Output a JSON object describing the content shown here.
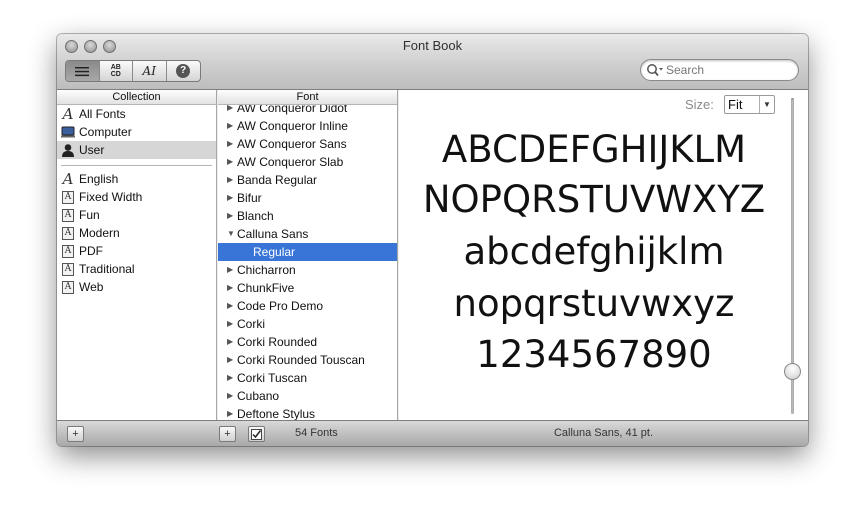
{
  "window": {
    "title": "Font Book"
  },
  "toolbar": {
    "view_buttons": [
      {
        "name": "list-view-icon"
      },
      {
        "name": "abcd-sample-icon",
        "glyph_top": "AB",
        "glyph_bottom": "CD"
      },
      {
        "name": "text-sample-icon",
        "glyph": "AI"
      },
      {
        "name": "info-icon",
        "glyph": "?"
      }
    ],
    "search": {
      "placeholder": "Search"
    }
  },
  "collection": {
    "header": "Collection",
    "system_items": [
      {
        "label": "All Fonts",
        "icon": "font-script-icon"
      },
      {
        "label": "Computer",
        "icon": "computer-icon"
      },
      {
        "label": "User",
        "icon": "user-icon",
        "selected": true
      }
    ],
    "user_items": [
      {
        "label": "English",
        "icon": "font-script-icon"
      },
      {
        "label": "Fixed Width",
        "icon": "collection-icon"
      },
      {
        "label": "Fun",
        "icon": "collection-icon"
      },
      {
        "label": "Modern",
        "icon": "collection-icon"
      },
      {
        "label": "PDF",
        "icon": "collection-icon"
      },
      {
        "label": "Traditional",
        "icon": "collection-icon"
      },
      {
        "label": "Web",
        "icon": "collection-icon"
      }
    ]
  },
  "fonts": {
    "header": "Font",
    "items": [
      {
        "label": "AW Conqueror Didot",
        "expanded": false
      },
      {
        "label": "AW Conqueror Inline",
        "expanded": false
      },
      {
        "label": "AW Conqueror Sans",
        "expanded": false
      },
      {
        "label": "AW Conqueror Slab",
        "expanded": false
      },
      {
        "label": "Banda Regular",
        "expanded": false
      },
      {
        "label": "Bifur",
        "expanded": false
      },
      {
        "label": "Blanch",
        "expanded": false
      },
      {
        "label": "Calluna Sans",
        "expanded": true
      },
      {
        "label": "Regular",
        "child": true,
        "selected": true
      },
      {
        "label": "Chicharron",
        "expanded": false
      },
      {
        "label": "ChunkFive",
        "expanded": false
      },
      {
        "label": "Code Pro Demo",
        "expanded": false
      },
      {
        "label": "Corki",
        "expanded": false
      },
      {
        "label": "Corki Rounded",
        "expanded": false
      },
      {
        "label": "Corki Rounded Touscan",
        "expanded": false
      },
      {
        "label": "Corki Tuscan",
        "expanded": false
      },
      {
        "label": "Cubano",
        "expanded": false
      },
      {
        "label": "Deftone Stylus",
        "expanded": false
      }
    ]
  },
  "preview": {
    "size_label": "Size:",
    "size_value": "Fit",
    "lines": [
      "ABCDEFGHIJKLM",
      "NOPQRSTUVWXYZ",
      "abcdefghijklm",
      "nopqrstuvwxyz",
      "1234567890"
    ]
  },
  "statusbar": {
    "add_label": "+",
    "font_count": "54 Fonts",
    "selection_info": "Calluna Sans, 41 pt."
  }
}
